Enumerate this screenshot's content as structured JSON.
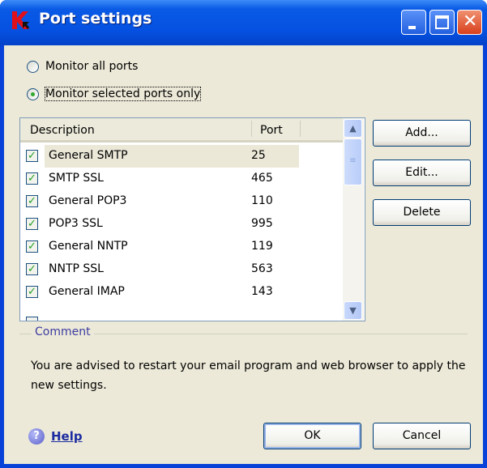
{
  "window": {
    "title": "Port settings"
  },
  "options": {
    "monitor_all": "Monitor all ports",
    "monitor_selected": "Monitor selected ports only",
    "selected": "monitor_selected"
  },
  "table": {
    "columns": [
      "Description",
      "Port"
    ],
    "rows": [
      {
        "description": "General SMTP",
        "port": "25",
        "checked": true
      },
      {
        "description": "SMTP SSL",
        "port": "465",
        "checked": true
      },
      {
        "description": "General POP3",
        "port": "110",
        "checked": true
      },
      {
        "description": "POP3 SSL",
        "port": "995",
        "checked": true
      },
      {
        "description": "General NNTP",
        "port": "119",
        "checked": true
      },
      {
        "description": "NNTP SSL",
        "port": "563",
        "checked": true
      },
      {
        "description": "General IMAP",
        "port": "143",
        "checked": true
      }
    ]
  },
  "buttons": {
    "add": "Add...",
    "edit": "Edit...",
    "delete": "Delete",
    "ok": "OK",
    "cancel": "Cancel"
  },
  "comment": {
    "label": "Comment",
    "text": "You are advised to restart your email program and web browser to apply the new settings."
  },
  "help": "Help"
}
